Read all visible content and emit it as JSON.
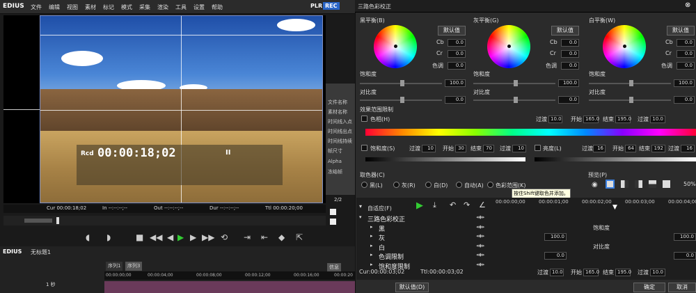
{
  "app": {
    "name": "EDIUS",
    "menus": [
      "文件",
      "编辑",
      "视图",
      "素材",
      "标记",
      "模式",
      "采集",
      "渲染",
      "工具",
      "设置",
      "帮助"
    ],
    "plr": "PLR",
    "rec": "REC"
  },
  "player": {
    "timecode_label": "Rcd",
    "timecode": "00:00:18;02",
    "pause": "II",
    "info": {
      "cur_label": "Cur",
      "cur": "00:00:18;02",
      "in_label": "In",
      "in": "--:--:--;--",
      "out_label": "Out",
      "out": "--:--:--;--",
      "dur_label": "Dur",
      "dur": "--:--:--;--",
      "ttl_label": "Ttl",
      "ttl": "00:00:20;00"
    }
  },
  "properties": {
    "items": [
      "文件名称",
      "素材名称",
      "时间线入点",
      "时间线出点",
      "时间线持续",
      "帧尺寸",
      "Alpha",
      "冻结帧"
    ],
    "page": "2/2"
  },
  "timeline": {
    "project_label": "EDIUS",
    "project_name": "无标题1",
    "tabs": [
      "序列1",
      "序列3"
    ],
    "info_tab": "信息",
    "scale": "1 秒",
    "ruler": [
      "00:00:00;00",
      "00:00:04;00",
      "00:00:08;00",
      "00:00:12;00",
      "00:00:16;00",
      "00:00:20"
    ]
  },
  "dialog": {
    "title": "三路色彩校正",
    "wheels": [
      {
        "title": "黑平衡(B)",
        "default": "默认值",
        "cb_label": "Cb",
        "cb": "0.0",
        "cr_label": "Cr",
        "cr": "0.0",
        "hue_label": "色调",
        "hue": "0.0",
        "sat_label": "饱和度",
        "sat": "100.0",
        "con_label": "对比度",
        "con": "0.0"
      },
      {
        "title": "灰平衡(G)",
        "default": "默认值",
        "cb_label": "Cb",
        "cb": "0.0",
        "cr_label": "Cr",
        "cr": "0.0",
        "hue_label": "色调",
        "hue": "0.0",
        "sat_label": "饱和度",
        "sat": "100.0",
        "con_label": "对比度",
        "con": "0.0"
      },
      {
        "title": "白平衡(W)",
        "default": "默认值",
        "cb_label": "Cb",
        "cb": "0.0",
        "cr_label": "Cr",
        "cr": "0.0",
        "hue_label": "色调",
        "hue": "0.0",
        "sat_label": "饱和度",
        "sat": "100.0",
        "con_label": "对比度",
        "con": "0.0"
      }
    ],
    "range": {
      "title": "效果范围限制",
      "hue_label": "色相(H)",
      "trans_label": "过渡",
      "trans": "10.0",
      "start_label": "开始",
      "start": "165.0",
      "end_label": "结束",
      "end": "195.0",
      "trans2": "10.0",
      "sat_label": "饱和度(S)",
      "sat_trans": "10",
      "sat_start": "30",
      "sat_end": "70",
      "sat_trans2": "10",
      "lum_label": "亮度(L)",
      "lum_trans": "16",
      "lum_start": "64",
      "lum_end": "192",
      "lum_trans2": "16"
    },
    "picker": {
      "title": "取色器(C)",
      "options": [
        "黑(L)",
        "灰(R)",
        "白(D)",
        "自动(A)",
        "色彩范围(K)"
      ],
      "tooltip": "按住Shift键取色并添加。"
    },
    "preview": {
      "title": "预览(P)",
      "zoom": "50%"
    },
    "keyframe": {
      "fit": "自适应(F)",
      "tree": [
        "三路色彩校正",
        "黑",
        "灰",
        "白",
        "色调限制",
        "饱和度限制"
      ],
      "ruler": [
        "00:00:00;00",
        "00:00:01;00",
        "00:00:02;00",
        "00:00:03;00",
        "00:00:04;00"
      ],
      "sat_label": "饱和度",
      "sat": "100.0",
      "con_label": "对比度",
      "con": "0.0",
      "sat2": "100.0",
      "con2": "0.0",
      "cur_label": "Cur:",
      "cur": "00:00:03;02",
      "ttl_label": "Ttl:",
      "ttl": "00:00:03;02",
      "bottom_trans": "过渡",
      "bt1": "10.0",
      "bottom_start": "开始",
      "bt2": "165.0",
      "bottom_end": "结束",
      "bt3": "195.0",
      "bottom_trans2": "过渡",
      "bt4": "10.0"
    },
    "default_btn": "默认值(D)",
    "ok": "确定",
    "cancel": "取消"
  }
}
